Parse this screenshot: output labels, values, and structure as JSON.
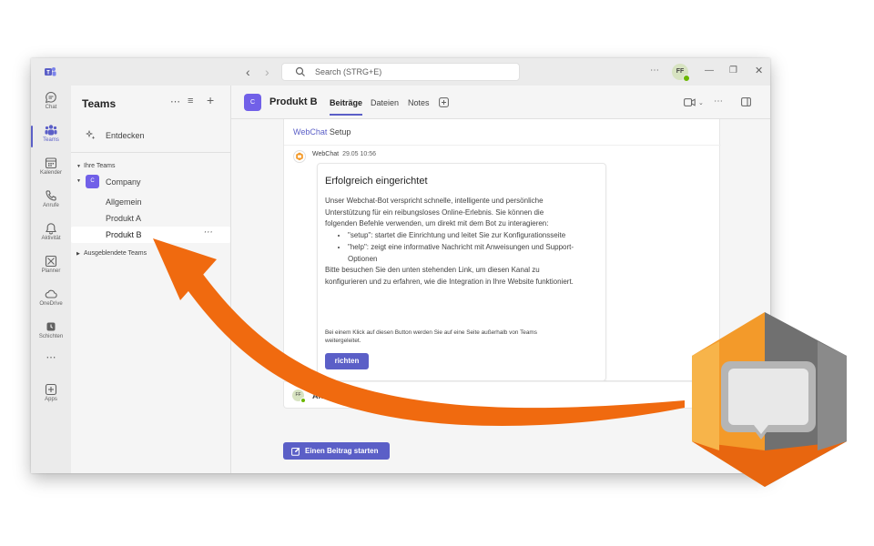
{
  "search": {
    "placeholder": "Search (STRG+E)"
  },
  "user": {
    "initials": "FF"
  },
  "rail": {
    "items": [
      {
        "label": "Chat",
        "icon": "chat-icon"
      },
      {
        "label": "Teams",
        "icon": "teams-icon"
      },
      {
        "label": "Kalender",
        "icon": "calendar-icon"
      },
      {
        "label": "Anrufe",
        "icon": "phone-icon"
      },
      {
        "label": "Aktivität",
        "icon": "bell-icon"
      },
      {
        "label": "Planner",
        "icon": "planner-icon"
      },
      {
        "label": "OneDrive",
        "icon": "cloud-icon"
      },
      {
        "label": "Schichten",
        "icon": "shifts-icon"
      },
      {
        "label": "Apps",
        "icon": "add-app-icon"
      }
    ]
  },
  "panel": {
    "title": "Teams",
    "discover": "Entdecken",
    "your_teams": "Ihre Teams",
    "team": {
      "initial": "C",
      "name": "Company"
    },
    "channels": [
      "Allgemein",
      "Produkt A",
      "Produkt B"
    ],
    "hidden_teams": "Ausgeblendete Teams"
  },
  "channel": {
    "initial": "C",
    "name": "Produkt B",
    "tabs": [
      "Beiträge",
      "Dateien",
      "Notes"
    ]
  },
  "post": {
    "title_app": "WebChat",
    "title_rest": " Setup",
    "author": "WebChat",
    "time": "29.05 10:56",
    "heading": "Erfolgreich eingerichtet",
    "intro": "Unser Webchat-Bot verspricht schnelle, intelligente und persönliche Unterstützung für ein reibungsloses Online-Erlebnis. Sie können die folgenden Befehle verwenden, um direkt mit dem Bot zu interagieren:",
    "bullets": [
      "\"setup\": startet die Einrichtung und leitet Sie zur Konfigurationsseite",
      "\"help\": zeigt eine informative Nachricht mit Anweisungen und Support-Optionen"
    ],
    "outro": "Bitte besuchen Sie den unten stehenden Link, um diesen Kanal zu konfigurieren und zu erfahren, wie die Integration in Ihre Website funktioniert.",
    "note": "Bei einem Klick auf diesen Button werden Sie auf eine Seite außerhalb von Teams weitergeleitet.",
    "button": "richten",
    "reply": "Antworten",
    "reply_initials": "FF"
  },
  "new_post": "Einen Beitrag starten",
  "colors": {
    "accent": "#5b5fc7",
    "team_avatar": "#7160e8",
    "arrow": "#f06a0f",
    "logo_orange": "#f39a2a",
    "logo_gray": "#707070",
    "presence": "#6bb700"
  }
}
